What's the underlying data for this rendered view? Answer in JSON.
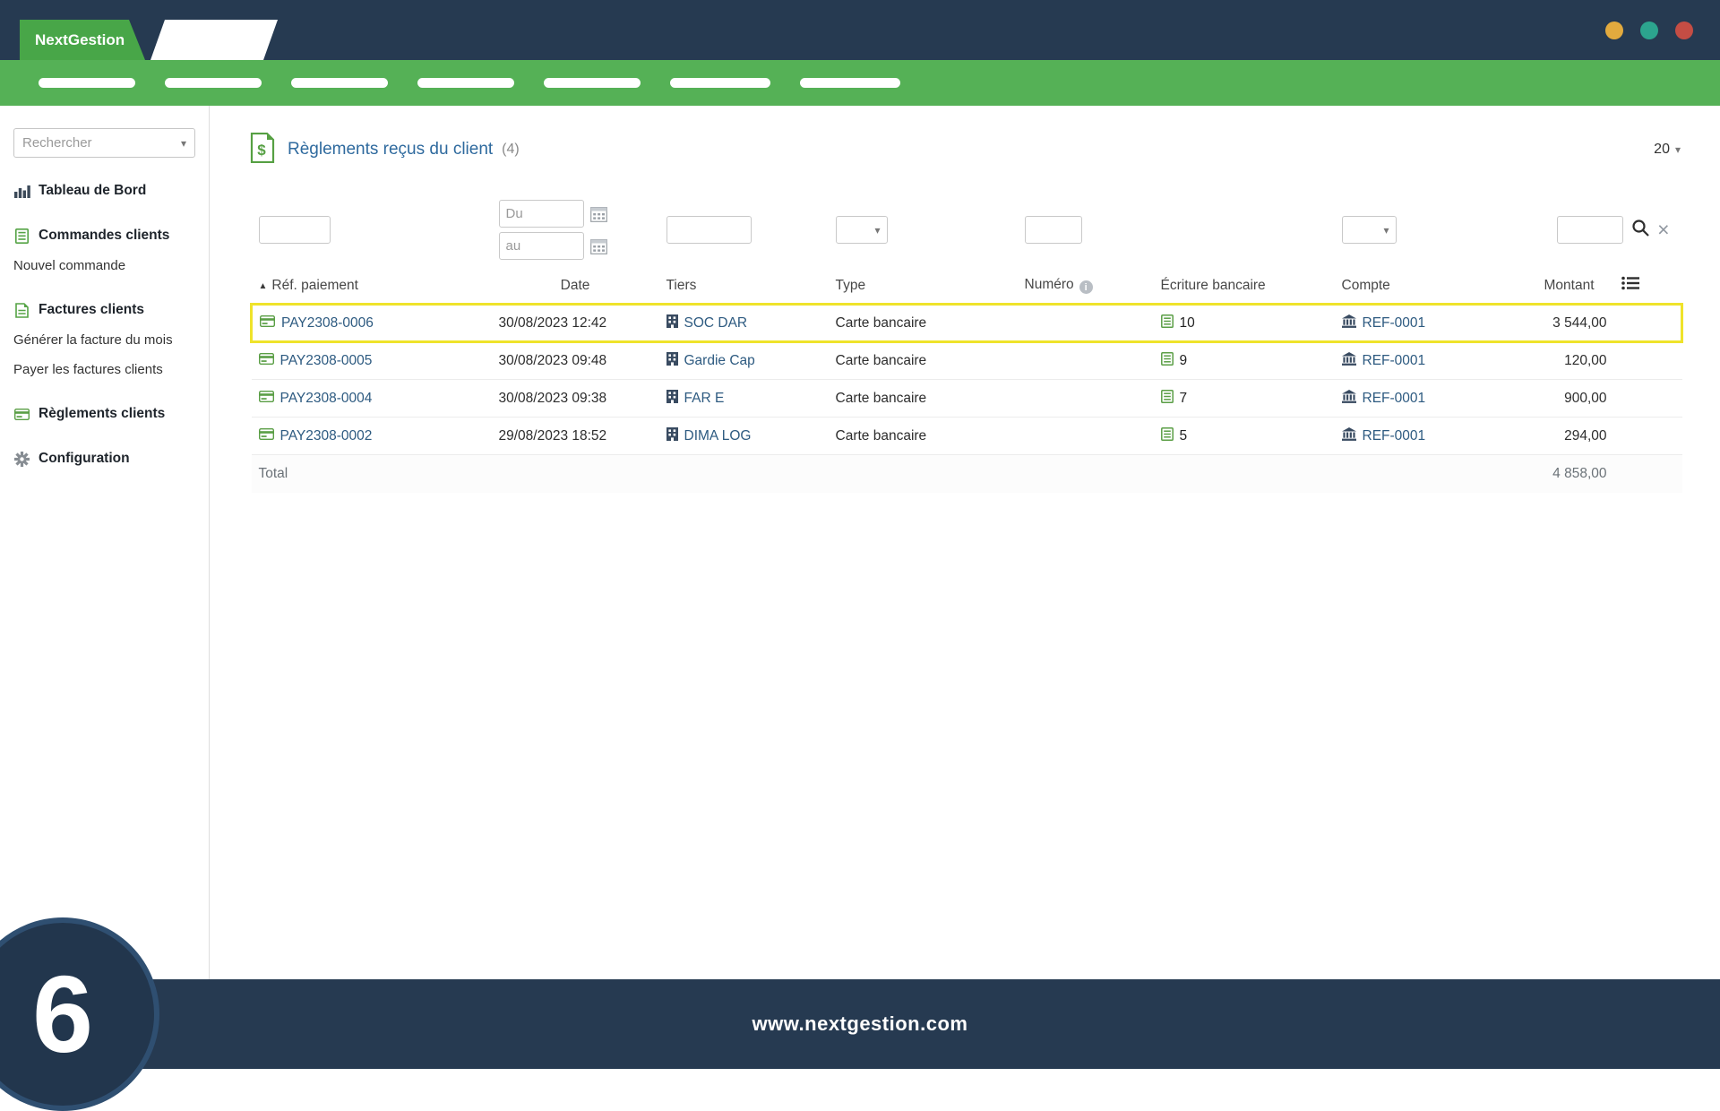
{
  "colors": {
    "navy": "#263a51",
    "green": "#55b156",
    "tab_green": "#48a648",
    "title_blue": "#2f6a9e",
    "link": "#2d5a80",
    "amount": "#3f6fa9",
    "highlight": "#efe32b",
    "dot_yellow": "#e2aa3e",
    "dot_teal": "#2ca48e",
    "dot_red": "#c44d44"
  },
  "icons": {
    "caret_down": "▾",
    "sort_asc": "▲",
    "close": "×",
    "info": "i"
  },
  "topbar": {
    "brand": "NextGestion"
  },
  "sidebar": {
    "search_placeholder": "Rechercher",
    "items": [
      {
        "label": "Tableau de Bord"
      },
      {
        "label": "Commandes clients"
      },
      {
        "label": "Nouvel commande"
      },
      {
        "label": "Factures clients"
      },
      {
        "label": "Générer la facture du mois"
      },
      {
        "label": "Payer les factures clients"
      },
      {
        "label": "Règlements clients"
      },
      {
        "label": "Configuration"
      }
    ]
  },
  "page": {
    "title": "Règlements reçus du client",
    "count": "(4)",
    "page_size": "20"
  },
  "filters": {
    "date_from_placeholder": "Du",
    "date_to_placeholder": "au"
  },
  "table": {
    "columns": {
      "ref": "Réf. paiement",
      "date": "Date",
      "tiers": "Tiers",
      "type": "Type",
      "numero": "Numéro",
      "ecriture": "Écriture bancaire",
      "compte": "Compte",
      "montant": "Montant"
    },
    "rows": [
      {
        "ref": "PAY2308-0006",
        "date": "30/08/2023 12:42",
        "tiers": "SOC DAR",
        "type": "Carte bancaire",
        "ecriture": "10",
        "compte": "REF-0001",
        "montant": "3 544,00"
      },
      {
        "ref": "PAY2308-0005",
        "date": "30/08/2023 09:48",
        "tiers": "Gardie Cap",
        "type": "Carte bancaire",
        "ecriture": "9",
        "compte": "REF-0001",
        "montant": "120,00"
      },
      {
        "ref": "PAY2308-0004",
        "date": "30/08/2023 09:38",
        "tiers": "FAR E",
        "type": "Carte bancaire",
        "ecriture": "7",
        "compte": "REF-0001",
        "montant": "900,00"
      },
      {
        "ref": "PAY2308-0002",
        "date": "29/08/2023 18:52",
        "tiers": "DIMA LOG",
        "type": "Carte bancaire",
        "ecriture": "5",
        "compte": "REF-0001",
        "montant": "294,00"
      }
    ],
    "total_label": "Total",
    "total_value": "4 858,00"
  },
  "footer": {
    "url": "www.nextgestion.com"
  },
  "badge": {
    "number": "6"
  }
}
